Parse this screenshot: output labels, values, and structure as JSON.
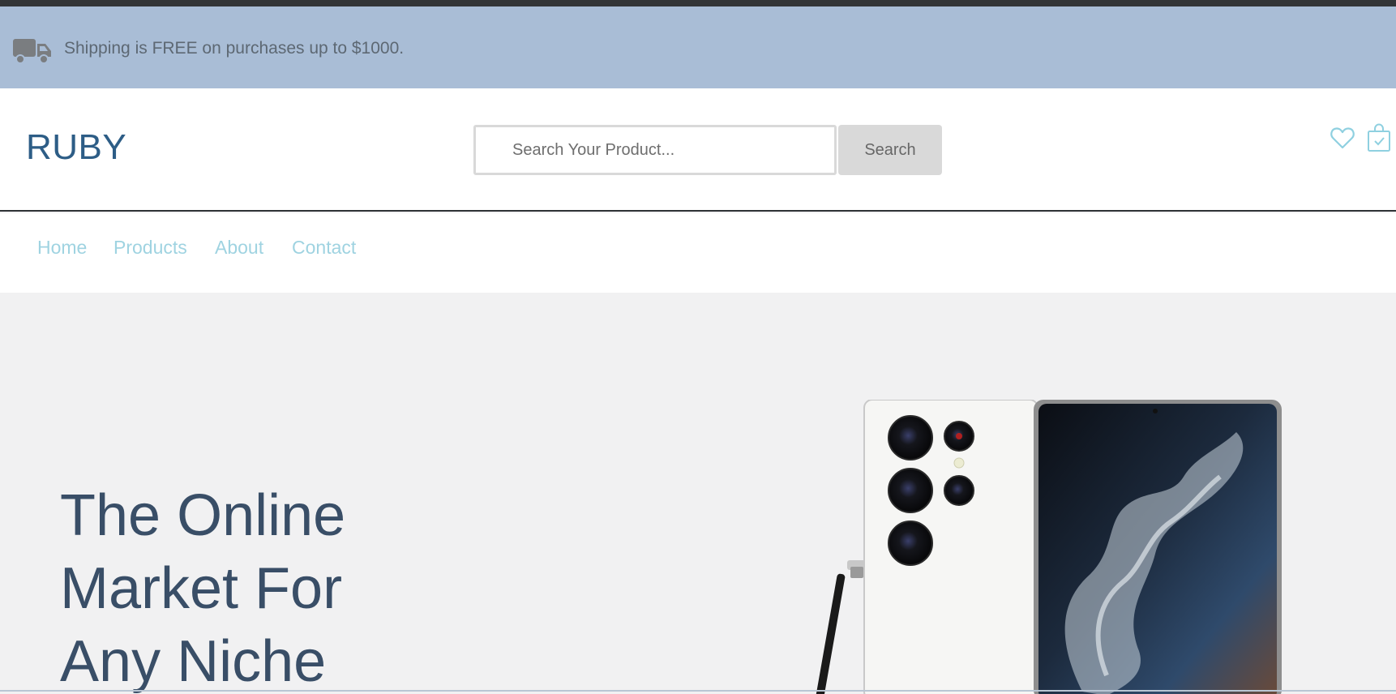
{
  "shipping": {
    "icon": "truck-icon",
    "text": "Shipping is FREE on purchases up to $1000."
  },
  "header": {
    "logo": "RUBY",
    "search": {
      "placeholder": "Search Your Product...",
      "value": "",
      "button_label": "Search"
    },
    "icons": [
      "heart-icon",
      "shopping-bag-icon"
    ]
  },
  "nav": {
    "items": [
      {
        "label": "Home"
      },
      {
        "label": "Products"
      },
      {
        "label": "About"
      },
      {
        "label": "Contact"
      }
    ]
  },
  "hero": {
    "title_lines": [
      "The Online",
      "Market For",
      "Any Niche"
    ]
  },
  "colors": {
    "shipping_bar": "#a9bdd6",
    "logo": "#2d5d86",
    "nav_link": "#9fd3e1",
    "hero_title": "#394e67",
    "hero_bg": "#f1f1f2",
    "accent_icon": "#8fd0e0"
  }
}
